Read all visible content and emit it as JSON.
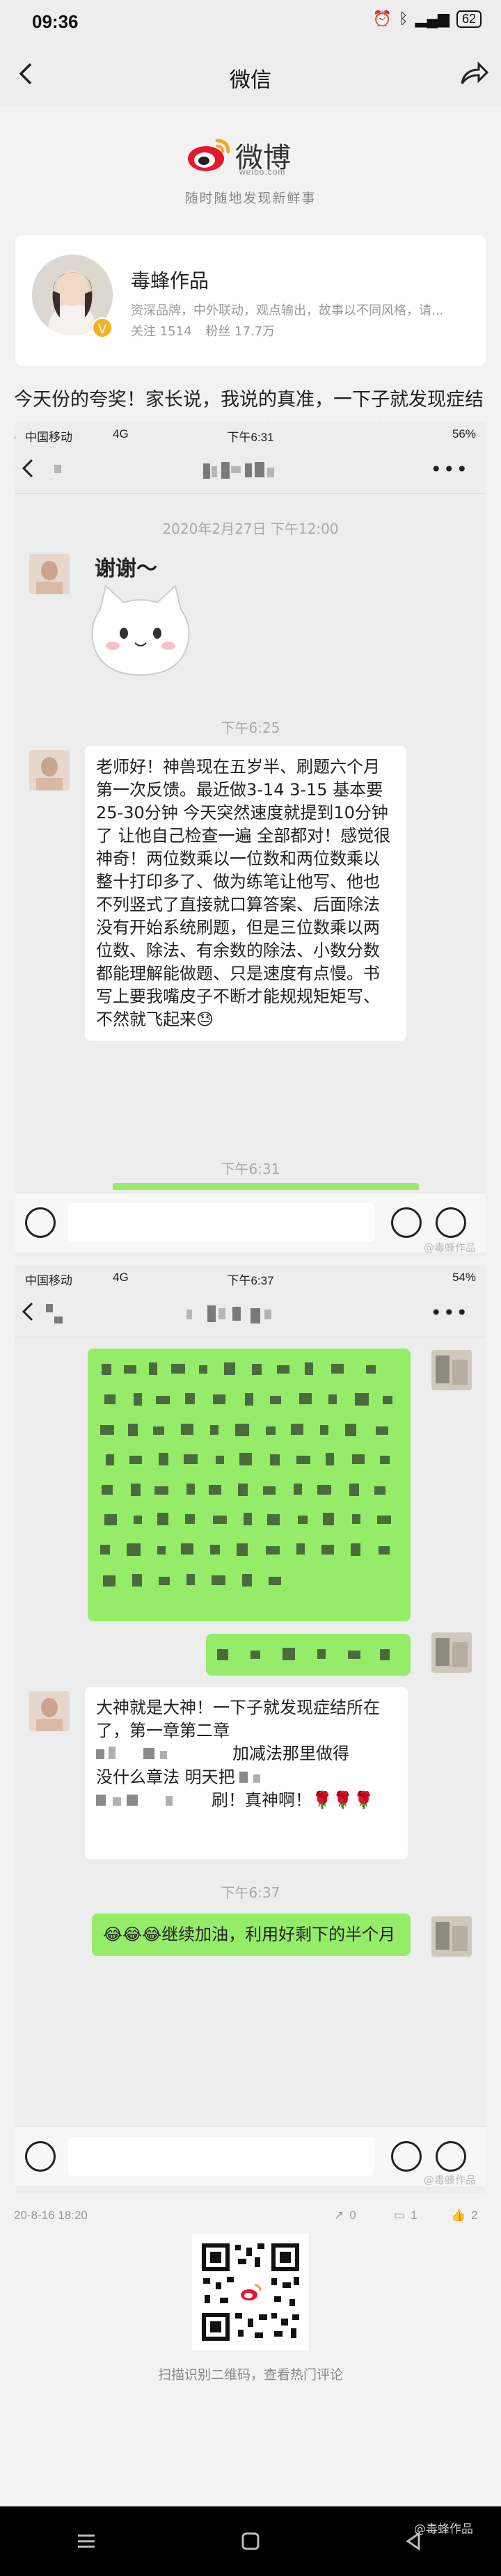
{
  "status_bar": {
    "time": "09:36",
    "battery": "62"
  },
  "nav": {
    "title": "微信"
  },
  "weibo": {
    "name": "微博",
    "domain": "weibo.com",
    "slogan": "随时随地发现新鲜事"
  },
  "profile": {
    "username": "毒蜂作品",
    "bio": "资深品牌，中外联动，观点输出，故事以不同风格，请...",
    "follows": "关注 1514",
    "fans": "粉丝 17.7万"
  },
  "post": {
    "text": "今天份的夸奖！家长说，我说的真准，一下子就发现症结所在，真神。哈哈哈哈哈，我当然了解，因为我做过很多实验啊！那么多孩子，表现都一样，说明这就是规律了。"
  },
  "screenshot1": {
    "carrier": "中国移动",
    "network": "4G",
    "time": "下午6:31",
    "battery": "56%",
    "timestamp1": "2020年2月27日 下午12:00",
    "sticker_text": "谢谢～",
    "timestamp2": "下午6:25",
    "message": "老师好！神兽现在五岁半、刷题六个月第一次反馈。最近做3-14 3-15 基本要25-30分钟 今天突然速度就提到10分钟了 让他自己检查一遍 全部都对！感觉很神奇！两位数乘以一位数和两位数乘以整十打印多了、做为练笔让他写、他也不列竖式了直接就口算答案、后面除法没有开始系统刷题，但是三位数乘以两位数、除法、有余数的除法、小数分数都能理解能做题、只是速度有点慢。书写上要我嘴皮子不断才能规规矩矩写、不然就飞起来😓",
    "timestamp3": "下午6:31",
    "watermark": "@毒蜂作品"
  },
  "screenshot2": {
    "carrier": "中国移动",
    "network": "4G",
    "time": "下午6:37",
    "battery": "54%",
    "msg_line1": "大神就是大神！一下子就发现症结所在了，第一章第二章",
    "msg_mid": "加减法那里做得",
    "msg_line3": "没什么章法 明天把",
    "msg_line4": "刷！真神啊！🌹🌹🌹",
    "timestamp": "下午6:37",
    "reply": "😂😂😂继续加油，利用好剩下的半个月",
    "watermark": "@毒蜂作品"
  },
  "footer": {
    "date": "20-8-16 18:20",
    "share_count": "0",
    "comment_count": "1",
    "like_count": "2",
    "qr_caption": "扫描识别二维码，查看热门评论",
    "watermark": "@毒蜂作品"
  },
  "colors": {
    "bubble_green": "#95ec69",
    "weibo_red": "#e6162d",
    "weibo_orange": "#f5a623"
  }
}
